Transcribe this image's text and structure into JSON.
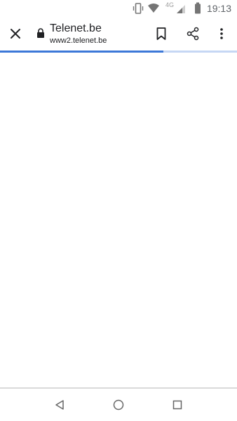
{
  "status_bar": {
    "time": "19:13",
    "network": "4G",
    "icons": [
      "vibrate-icon",
      "wifi-icon",
      "cell-signal-icon",
      "battery-icon"
    ]
  },
  "toolbar": {
    "title": "Telenet.be",
    "url": "www2.telenet.be",
    "icons": [
      "close-icon",
      "lock-icon",
      "bookmark-icon",
      "share-icon",
      "more-vert-icon"
    ]
  },
  "progress": {
    "fraction": 0.69,
    "colors": {
      "fill": "#3c78d8",
      "track": "#c6d7f4"
    }
  },
  "nav_bar": {
    "icons": [
      "back-icon",
      "home-icon",
      "recents-icon"
    ]
  }
}
